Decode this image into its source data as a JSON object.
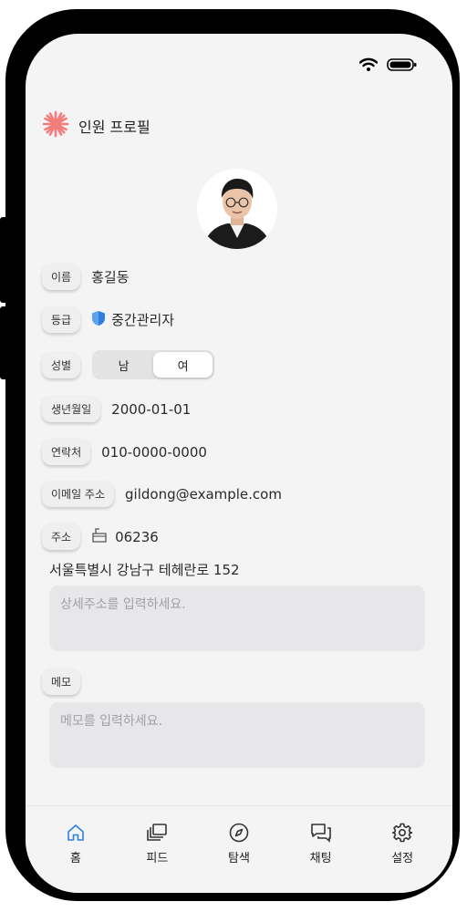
{
  "header": {
    "title": "인원 프로필",
    "logo_icon": "flower-logo-icon",
    "accent": "#f07c7c"
  },
  "status": {
    "wifi_icon": "wifi-icon",
    "battery_icon": "battery-icon"
  },
  "profile": {
    "name_label": "이름",
    "name": "홍길동",
    "grade_label": "등급",
    "grade": "중간관리자",
    "grade_icon": "shield-icon",
    "grade_color": "#2f7fe0",
    "gender_label": "성별",
    "gender_options": [
      "남",
      "여"
    ],
    "gender_selected": "여",
    "birth_label": "생년월일",
    "birth": "2000-01-01",
    "phone_label": "연락처",
    "phone": "010-0000-0000",
    "email_label": "이메일 주소",
    "email": "gildong@example.com",
    "address_label": "주소",
    "postcode": "06236",
    "postbox_icon": "mailbox-icon",
    "address": "서울특별시 강남구 테헤란로 152",
    "address_detail_placeholder": "상세주소를 입력하세요.",
    "memo_label": "메모",
    "memo_placeholder": "메모를 입력하세요."
  },
  "tabbar": {
    "items": [
      {
        "label": "홈",
        "icon": "home-icon",
        "active": true
      },
      {
        "label": "피드",
        "icon": "feed-icon",
        "active": false
      },
      {
        "label": "탐색",
        "icon": "compass-icon",
        "active": false
      },
      {
        "label": "채팅",
        "icon": "chat-icon",
        "active": false
      },
      {
        "label": "설정",
        "icon": "gear-icon",
        "active": false
      }
    ],
    "active_color": "#2f7fe0"
  }
}
